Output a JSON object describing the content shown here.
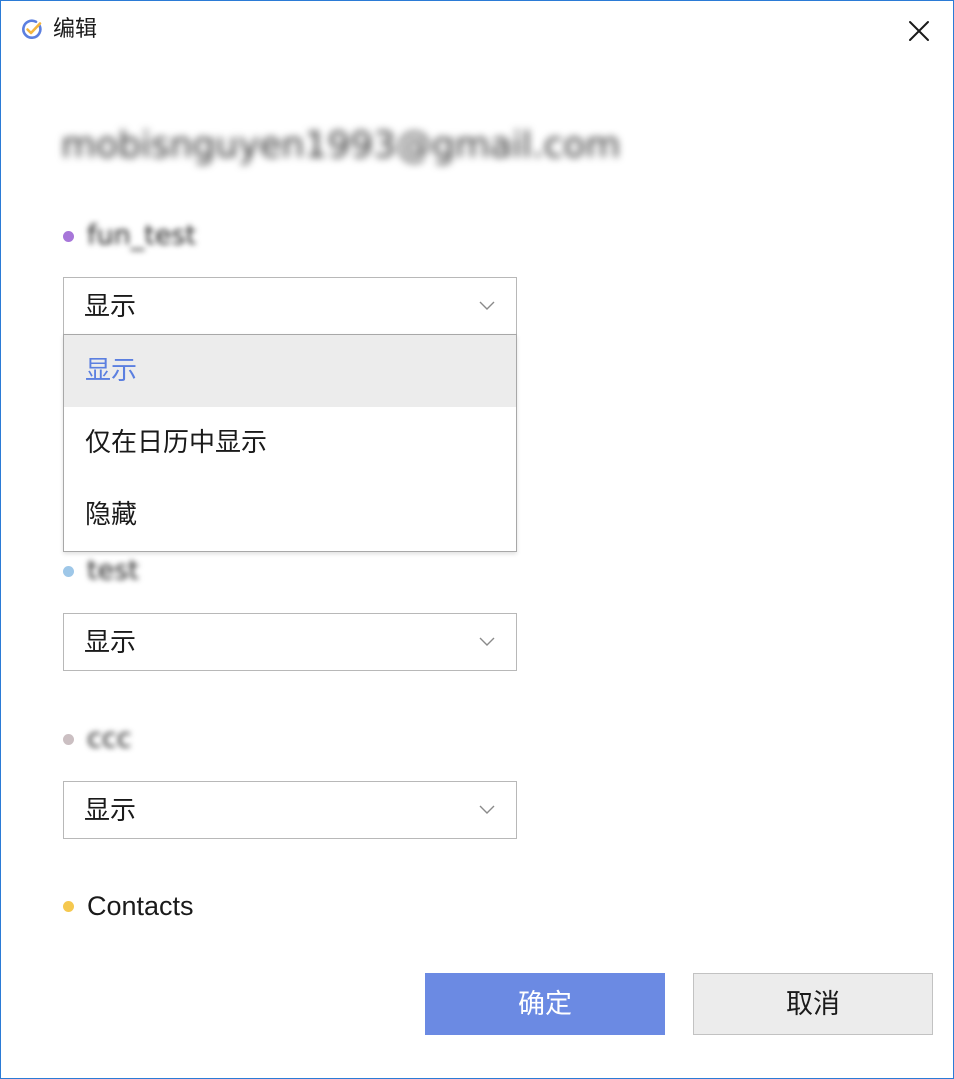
{
  "window": {
    "title": "编辑",
    "close_icon": "close-icon",
    "app_icon": "ticktick-check-icon"
  },
  "account": {
    "email": "mobisnguyen1993@gmail.com"
  },
  "calendars": [
    {
      "name": "fun_test",
      "dot_color": "#a776d9",
      "visibility": "显示",
      "dropdown_open": true
    },
    {
      "name": "test",
      "dot_color": "#9ec7e8",
      "visibility": "显示",
      "dropdown_open": false
    },
    {
      "name": "ccc",
      "dot_color": "#cbbfc2",
      "visibility": "显示",
      "dropdown_open": false
    },
    {
      "name": "Contacts",
      "dot_color": "#f5c84f"
    }
  ],
  "dropdown": {
    "options": [
      "显示",
      "仅在日历中显示",
      "隐藏"
    ],
    "selected": "显示"
  },
  "colors": {
    "accent": "#6b8ae3",
    "selected_text": "#5b7fe0",
    "window_border": "#2b7bd6"
  },
  "buttons": {
    "confirm": "确定",
    "cancel": "取消"
  }
}
